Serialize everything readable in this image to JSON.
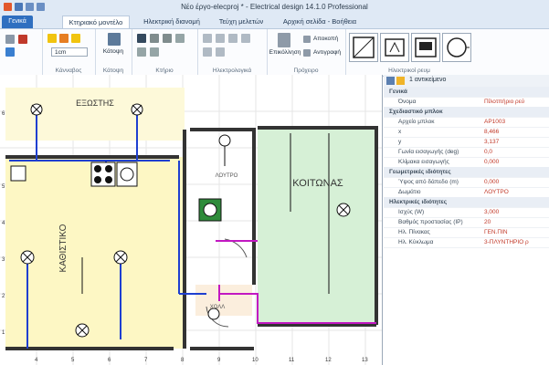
{
  "window": {
    "title": "Νέο έργο-elecproj * - Electrical design 14.1.0 Professional"
  },
  "tabs": {
    "file": "Γενικά",
    "items": [
      "Κτηριακό μοντέλο",
      "Ηλεκτρική διανομή",
      "Τεύχη μελετών",
      "Αρχική σελίδα - Βοήθεια"
    ]
  },
  "ribbon": {
    "scale": "1cm",
    "groups": [
      "Κάνναβος",
      "Κάτοψη",
      "Κτήριο",
      "Ηλεκτρολογικά",
      "Πρόχειρο",
      "Ηλεκτρικοί ρευμ"
    ],
    "floor_label": "Κάτοψη",
    "clipboard": {
      "paste": "Επικόλληση",
      "cut": "Αποκοπή",
      "copy": "Αντιγραφή"
    }
  },
  "plan": {
    "rooms": [
      "ΕΞΩΣΤΗΣ",
      "ΚΑΘΙΣΤΙΚΟ",
      "ΛΟΥΤΡΟ",
      "ΚΟΙΤΩΝΑΣ",
      "ΧΩΛΛ"
    ],
    "ruler_left": [
      "6",
      "5",
      "4",
      "3",
      "2",
      "1"
    ],
    "ruler_bottom": [
      "4",
      "5",
      "6",
      "7",
      "8",
      "9",
      "10",
      "11",
      "12",
      "13"
    ]
  },
  "properties": {
    "header": "1 αντικείμενο",
    "sections": [
      {
        "title": "Γενικά",
        "rows": [
          {
            "k": "Όνομα",
            "v": "Πίλοτπήριο ρεύ"
          }
        ]
      },
      {
        "title": "Σχεδιαστικό μπλοκ",
        "rows": [
          {
            "k": "Αρχείο μπλοκ",
            "v": "ΑΡ1003"
          },
          {
            "k": "x",
            "v": "8,466"
          },
          {
            "k": "y",
            "v": "3,137"
          },
          {
            "k": "Γωνία εισαγωγής (deg)",
            "v": "0,0"
          },
          {
            "k": "Κλίμακα εισαγωγής",
            "v": "0,000"
          }
        ]
      },
      {
        "title": "Γεωμετρικές ιδιότητες",
        "rows": [
          {
            "k": "Ύψος από δάπεδο (m)",
            "v": "0,000"
          },
          {
            "k": "Δωμάτιο",
            "v": "ΛΟΥΤΡΟ"
          }
        ]
      },
      {
        "title": "Ηλεκτρικές ιδιότητες",
        "rows": [
          {
            "k": "Ισχύς (W)",
            "v": "3,000"
          },
          {
            "k": "Βαθμός προστασίας (IP)",
            "v": "20"
          },
          {
            "k": "Ηλ. Πίνακας",
            "v": "ΓΕΝ.ΠΙΝ"
          },
          {
            "k": "Ηλ. Κύκλωμα",
            "v": "3-ΠΛΥΝΤΗΡΙΟ ρ"
          }
        ]
      }
    ]
  }
}
